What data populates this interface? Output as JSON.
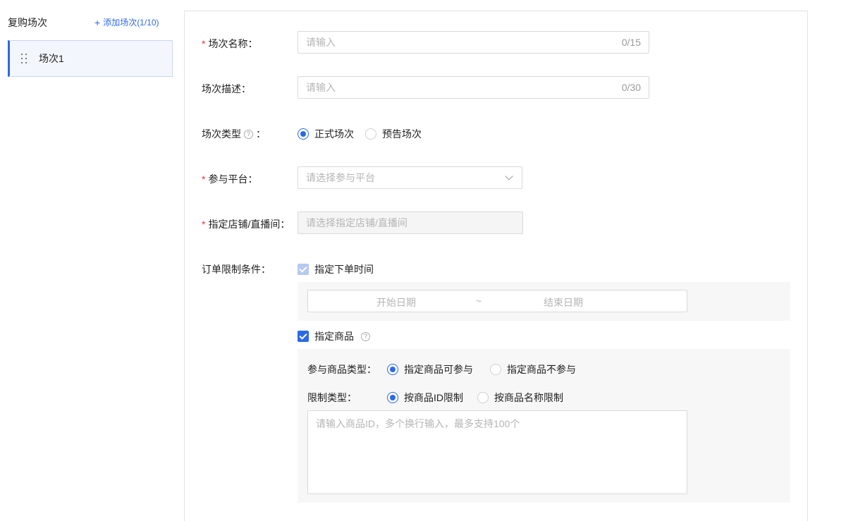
{
  "sidebar": {
    "title": "复购场次",
    "add_button": "添加场次(1/10)",
    "sessions": [
      {
        "label": "场次1"
      }
    ]
  },
  "form": {
    "name": {
      "label": "场次名称：",
      "placeholder": "请输入",
      "count": "0/15"
    },
    "description": {
      "label": "场次描述：",
      "placeholder": "请输入",
      "count": "0/30"
    },
    "type": {
      "label": "场次类型",
      "colon": "：",
      "options": [
        "正式场次",
        "预告场次"
      ],
      "selected": "正式场次"
    },
    "platform": {
      "label": "参与平台：",
      "placeholder": "请选择参与平台"
    },
    "store": {
      "label": "指定店铺/直播间：",
      "placeholder": "请选择指定店铺/直播间"
    },
    "order_limit": {
      "label": "订单限制条件：",
      "order_time": {
        "label": "指定下单时间",
        "checked": true,
        "disabled": true,
        "start_placeholder": "开始日期",
        "separator": "~",
        "end_placeholder": "结束日期"
      },
      "product": {
        "label": "指定商品",
        "checked": true,
        "participation": {
          "label": "参与商品类型：",
          "options": [
            "指定商品可参与",
            "指定商品不参与"
          ],
          "selected": "指定商品可参与"
        },
        "limit_type": {
          "label": "限制类型：",
          "options": [
            "按商品ID限制",
            "按商品名称限制"
          ],
          "selected": "按商品ID限制"
        },
        "textarea_placeholder": "请输入商品ID，多个换行输入，最多支持100个"
      }
    }
  },
  "colors": {
    "primary": "#2c6ae5",
    "required": "#e53935"
  },
  "icons": {
    "help": "help-circle-icon",
    "drag": "drag-handle-icon",
    "chevron": "chevron-down-icon",
    "plus": "plus-icon"
  }
}
